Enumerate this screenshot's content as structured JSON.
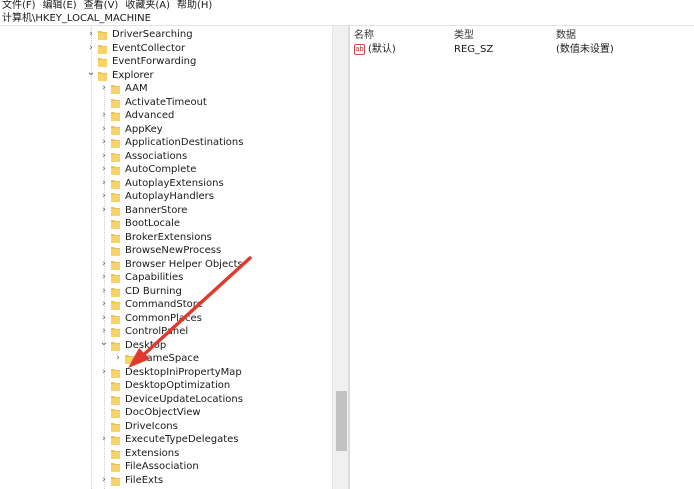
{
  "menu": [
    "文件(F)",
    "编辑(E)",
    "查看(V)",
    "收藏夹(A)",
    "帮助(H)"
  ],
  "address": "计算机\\HKEY_LOCAL_MACHINE",
  "tree": [
    {
      "label": "DriverSearching",
      "expander": "collapsed",
      "level": 1
    },
    {
      "label": "EventCollector",
      "expander": "collapsed",
      "level": 1
    },
    {
      "label": "EventForwarding",
      "expander": "none",
      "level": 1
    },
    {
      "label": "Explorer",
      "expander": "expanded",
      "level": 1
    },
    {
      "label": "AAM",
      "expander": "collapsed",
      "level": 2
    },
    {
      "label": "ActivateTimeout",
      "expander": "none",
      "level": 2
    },
    {
      "label": "Advanced",
      "expander": "collapsed",
      "level": 2
    },
    {
      "label": "AppKey",
      "expander": "collapsed",
      "level": 2
    },
    {
      "label": "ApplicationDestinations",
      "expander": "collapsed",
      "level": 2
    },
    {
      "label": "Associations",
      "expander": "collapsed",
      "level": 2
    },
    {
      "label": "AutoComplete",
      "expander": "collapsed",
      "level": 2
    },
    {
      "label": "AutoplayExtensions",
      "expander": "collapsed",
      "level": 2
    },
    {
      "label": "AutoplayHandlers",
      "expander": "collapsed",
      "level": 2
    },
    {
      "label": "BannerStore",
      "expander": "collapsed",
      "level": 2
    },
    {
      "label": "BootLocale",
      "expander": "none",
      "level": 2
    },
    {
      "label": "BrokerExtensions",
      "expander": "none",
      "level": 2
    },
    {
      "label": "BrowseNewProcess",
      "expander": "none",
      "level": 2
    },
    {
      "label": "Browser Helper Objects",
      "expander": "collapsed",
      "level": 2
    },
    {
      "label": "Capabilities",
      "expander": "collapsed",
      "level": 2
    },
    {
      "label": "CD Burning",
      "expander": "collapsed",
      "level": 2
    },
    {
      "label": "CommandStore",
      "expander": "collapsed",
      "level": 2
    },
    {
      "label": "CommonPlaces",
      "expander": "collapsed",
      "level": 2
    },
    {
      "label": "ControlPanel",
      "expander": "collapsed",
      "level": 2
    },
    {
      "label": "Desktop",
      "expander": "expanded",
      "level": 2
    },
    {
      "label": "NameSpace",
      "expander": "collapsed",
      "level": 3
    },
    {
      "label": "DesktopIniPropertyMap",
      "expander": "collapsed",
      "level": 2
    },
    {
      "label": "DesktopOptimization",
      "expander": "none",
      "level": 2
    },
    {
      "label": "DeviceUpdateLocations",
      "expander": "none",
      "level": 2
    },
    {
      "label": "DocObjectView",
      "expander": "none",
      "level": 2
    },
    {
      "label": "DriveIcons",
      "expander": "none",
      "level": 2
    },
    {
      "label": "ExecuteTypeDelegates",
      "expander": "collapsed",
      "level": 2
    },
    {
      "label": "Extensions",
      "expander": "none",
      "level": 2
    },
    {
      "label": "FileAssociation",
      "expander": "none",
      "level": 2
    },
    {
      "label": "FileExts",
      "expander": "collapsed",
      "level": 2
    }
  ],
  "values_panel": {
    "headers": {
      "name": "名称",
      "type": "类型",
      "data": "数据"
    },
    "rows": [
      {
        "icon": "string-value-icon",
        "name": "(默认)",
        "type": "REG_SZ",
        "data": "(数值未设置)"
      }
    ]
  },
  "colors": {
    "folder": "#f0c04a",
    "arrow": "#e03a2f"
  },
  "annotation": {
    "type": "arrow",
    "color": "#e03a2f",
    "target": "NameSpace"
  }
}
